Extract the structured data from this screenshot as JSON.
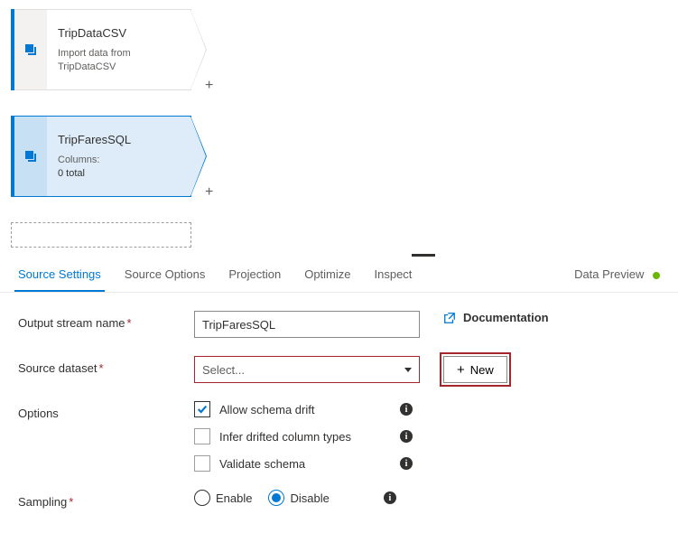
{
  "nodes": [
    {
      "title": "TripDataCSV",
      "subtitle": "Import data from TripDataCSV",
      "selected": false
    },
    {
      "title": "TripFaresSQL",
      "columns_label": "Columns:",
      "columns_total": "0 total",
      "selected": true
    }
  ],
  "tabs": {
    "source_settings": "Source Settings",
    "source_options": "Source Options",
    "projection": "Projection",
    "optimize": "Optimize",
    "inspect": "Inspect",
    "data_preview": "Data Preview"
  },
  "panel": {
    "output_stream_label": "Output stream name",
    "output_stream_value": "TripFaresSQL",
    "documentation_label": "Documentation",
    "source_dataset_label": "Source dataset",
    "select_placeholder": "Select...",
    "new_button": "New",
    "options_label": "Options",
    "opt_allow_drift": "Allow schema drift",
    "opt_infer_types": "Infer drifted column types",
    "opt_validate": "Validate schema",
    "sampling_label": "Sampling",
    "sampling_enable": "Enable",
    "sampling_disable": "Disable"
  }
}
